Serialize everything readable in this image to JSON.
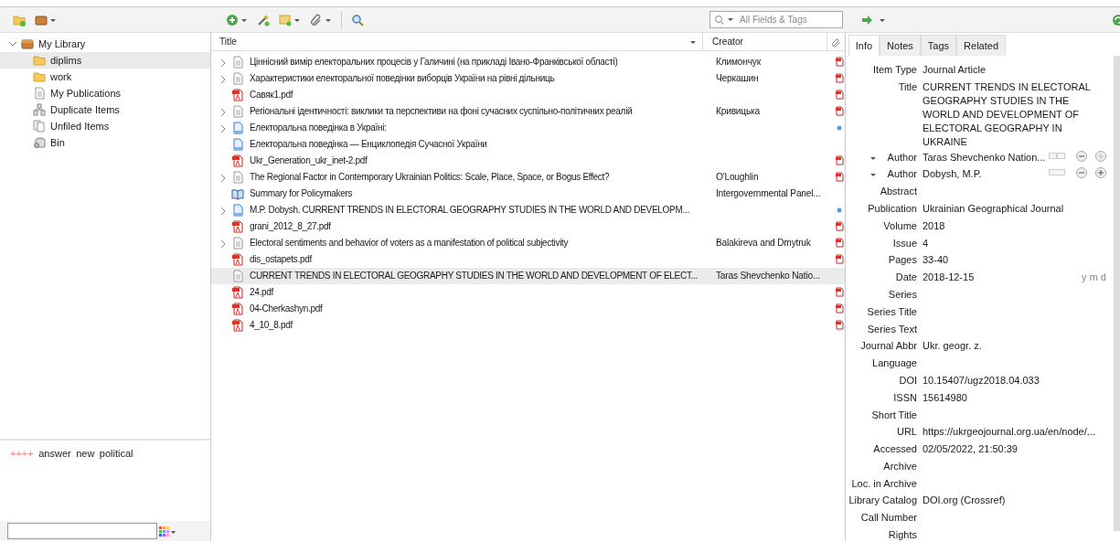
{
  "collections": [
    {
      "label": "My Library",
      "kind": "library",
      "expanded": true,
      "selected": false,
      "children": [
        {
          "label": "diplims",
          "kind": "folder",
          "selected": true
        },
        {
          "label": "work",
          "kind": "folder",
          "selected": false
        },
        {
          "label": "My Publications",
          "kind": "doc",
          "selected": false
        },
        {
          "label": "Duplicate Items",
          "kind": "duplicate",
          "selected": false
        },
        {
          "label": "Unfiled Items",
          "kind": "unfiled",
          "selected": false
        },
        {
          "label": "Bin",
          "kind": "bin",
          "selected": false
        }
      ]
    }
  ],
  "tags": [
    {
      "label": "++++",
      "color": "#f08c8c"
    },
    {
      "label": "answer",
      "color": "#222222"
    },
    {
      "label": "new",
      "color": "#222222"
    },
    {
      "label": "political",
      "color": "#222222"
    }
  ],
  "search": {
    "placeholder": "All Fields & Tags"
  },
  "table": {
    "columns": [
      "Title",
      "Creator"
    ],
    "rows": [
      {
        "title": "Ціннісний вимір електоральних процесів у Галичині (на прикладі Івано-Франківської області)",
        "creator": "Климончук",
        "kind": "doc",
        "expandable": true,
        "pdf_attachment": true,
        "selected": false
      },
      {
        "title": "Характеристики електоральної поведінки виборців України на рівні дільниць",
        "creator": "Черкашин",
        "kind": "doc",
        "expandable": true,
        "pdf_attachment": true,
        "selected": false
      },
      {
        "title": "Савяк1.pdf",
        "kind": "pdf",
        "expandable": false,
        "pdf_attachment": true,
        "selected": false
      },
      {
        "title": "Регіональні ідентичності: виклики та перспективи на фоні сучасних суспільно-політичних реалій",
        "creator": "Кривицька",
        "kind": "doc",
        "expandable": true,
        "pdf_attachment": true,
        "selected": false
      },
      {
        "title": "Електоральна поведінка в Україні:",
        "kind": "web",
        "expandable": true,
        "link_attachment": true,
        "selected": false
      },
      {
        "title": "Електоральна поведінка — Енциклопедія Сучасної України",
        "kind": "web",
        "expandable": false,
        "selected": false
      },
      {
        "title": "Ukr_Generation_ukr_inet-2.pdf",
        "kind": "pdf",
        "expandable": false,
        "pdf_attachment": true,
        "selected": false
      },
      {
        "title": "The Regional Factor in Contemporary Ukrainian Politics: Scale, Place, Space, or Bogus Effect?",
        "creator": "O'Loughlin",
        "kind": "doc",
        "expandable": true,
        "pdf_attachment": true,
        "selected": false
      },
      {
        "title": "Summary for Policymakers",
        "creator": "Intergovernmental Panel...",
        "kind": "book",
        "expandable": false,
        "selected": false
      },
      {
        "title": "M.P. Dobysh. CURRENT TRENDS IN ELECTORAL GEOGRAPHY STUDIES IN THE WORLD AND DEVELOPM...",
        "kind": "web",
        "expandable": true,
        "link_attachment": true,
        "selected": false
      },
      {
        "title": "grani_2012_8_27.pdf",
        "kind": "pdf",
        "expandable": false,
        "pdf_attachment": true,
        "selected": false
      },
      {
        "title": "Electoral sentiments and behavior of voters as a manifestation of political subjectivity",
        "creator": "Balakireva and Dmytruk",
        "kind": "doc",
        "expandable": true,
        "pdf_attachment": true,
        "selected": false
      },
      {
        "title": "dis_ostapets.pdf",
        "kind": "pdf",
        "expandable": false,
        "pdf_attachment": true,
        "selected": false
      },
      {
        "title": "CURRENT TRENDS IN ELECTORAL GEOGRAPHY STUDIES IN THE WORLD AND DEVELOPMENT OF ELECT...",
        "creator": "Taras Shevchenko Natio...",
        "kind": "doc",
        "expandable": false,
        "selected": true
      },
      {
        "title": "24.pdf",
        "kind": "pdf",
        "expandable": false,
        "pdf_attachment": true,
        "selected": false
      },
      {
        "title": "04-Cherkashyn.pdf",
        "kind": "pdf",
        "expandable": false,
        "pdf_attachment": true,
        "selected": false
      },
      {
        "title": "4_10_8.pdf",
        "kind": "pdf",
        "expandable": false,
        "pdf_attachment": true,
        "selected": false
      }
    ]
  },
  "item_pane": {
    "tabs": [
      {
        "label": "Info",
        "selected": true
      },
      {
        "label": "Notes",
        "selected": false
      },
      {
        "label": "Tags",
        "selected": false
      },
      {
        "label": "Related",
        "selected": false
      }
    ],
    "fields": [
      {
        "label": "Item Type",
        "value": "Journal Article",
        "kind": "plain"
      },
      {
        "label": "Title",
        "value": "CURRENT TRENDS IN ELECTORAL GEOGRAPHY STUDIES IN THE WORLD AND DEVELOPMENT OF ELECTORAL GEOGRAPHY IN UKRAINE",
        "kind": "plain"
      },
      {
        "label": "Author",
        "value": "Taras Shevchenko Nation...",
        "kind": "creator",
        "single_field": true
      },
      {
        "label": "Author",
        "value": "Dobysh, M.P.",
        "kind": "creator",
        "single_field": false
      },
      {
        "label": "Abstract",
        "kind": "plain"
      },
      {
        "label": "Publication",
        "value": "Ukrainian Geographical Journal",
        "kind": "plain"
      },
      {
        "label": "Volume",
        "value": "2018",
        "kind": "plain"
      },
      {
        "label": "Issue",
        "value": "4",
        "kind": "plain"
      },
      {
        "label": "Pages",
        "value": "33-40",
        "kind": "plain"
      },
      {
        "label": "Date",
        "value": "2018-12-15",
        "hint": "y m d",
        "kind": "date"
      },
      {
        "label": "Series",
        "kind": "plain"
      },
      {
        "label": "Series Title",
        "kind": "plain"
      },
      {
        "label": "Series Text",
        "kind": "plain"
      },
      {
        "label": "Journal Abbr",
        "value": "Ukr. geogr. z.",
        "kind": "plain"
      },
      {
        "label": "Language",
        "kind": "plain"
      },
      {
        "label": "DOI",
        "value": "10.15407/ugz2018.04.033",
        "kind": "plain"
      },
      {
        "label": "ISSN",
        "value": "15614980",
        "kind": "plain"
      },
      {
        "label": "Short Title",
        "kind": "plain"
      },
      {
        "label": "URL",
        "value": "https://ukrgeojournal.org.ua/en/node/...",
        "kind": "plain"
      },
      {
        "label": "Accessed",
        "value": "02/05/2022, 21:50:39",
        "kind": "plain"
      },
      {
        "label": "Archive",
        "kind": "plain"
      },
      {
        "label": "Loc. in Archive",
        "kind": "plain"
      },
      {
        "label": "Library Catalog",
        "value": "DOI.org (Crossref)",
        "kind": "plain"
      },
      {
        "label": "Call Number",
        "kind": "plain"
      },
      {
        "label": "Rights",
        "kind": "plain"
      }
    ]
  }
}
